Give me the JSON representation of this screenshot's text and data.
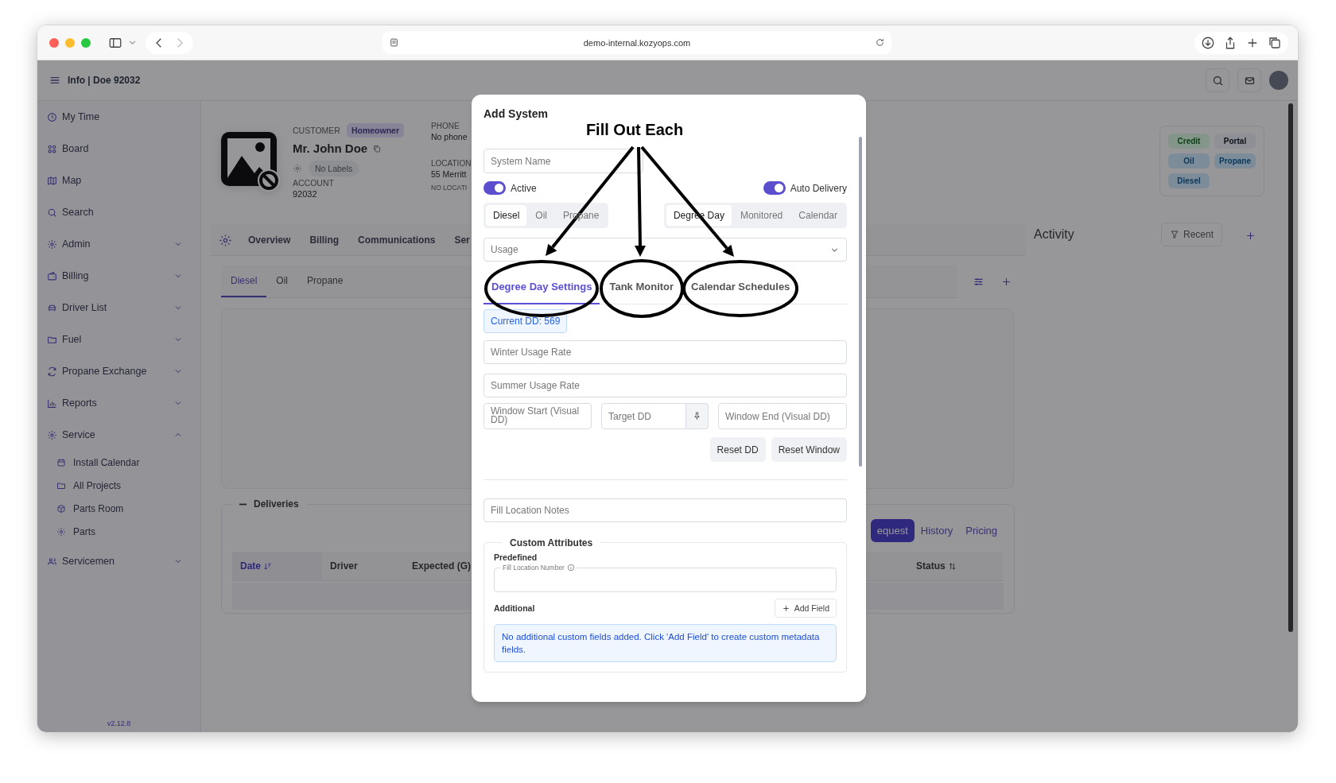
{
  "browser": {
    "url": "demo-internal.kozyops.com"
  },
  "header": {
    "title": "Info | Doe 92032"
  },
  "sidebar": {
    "items": [
      {
        "label": "My Time",
        "kind": "link"
      },
      {
        "label": "Board",
        "kind": "link"
      },
      {
        "label": "Map",
        "kind": "link"
      },
      {
        "label": "Search",
        "kind": "link"
      },
      {
        "label": "Admin",
        "kind": "group",
        "expanded": false
      },
      {
        "label": "Billing",
        "kind": "group",
        "expanded": false
      },
      {
        "label": "Driver List",
        "kind": "group",
        "expanded": false
      },
      {
        "label": "Fuel",
        "kind": "group",
        "expanded": false
      },
      {
        "label": "Propane Exchange",
        "kind": "group",
        "expanded": false
      },
      {
        "label": "Reports",
        "kind": "group",
        "expanded": false
      },
      {
        "label": "Service",
        "kind": "group",
        "expanded": true,
        "children": [
          {
            "label": "Install Calendar"
          },
          {
            "label": "All Projects"
          },
          {
            "label": "Parts Room"
          },
          {
            "label": "Parts"
          }
        ]
      },
      {
        "label": "Servicemen",
        "kind": "group",
        "expanded": false
      }
    ],
    "version": "v2.12.8"
  },
  "customer": {
    "label": "CUSTOMER",
    "badge": "Homeowner",
    "name": "Mr. John Doe",
    "labels": "No Labels",
    "account_label": "ACCOUNT",
    "account": "92032",
    "phone_label": "PHONE",
    "phone": "No phone",
    "location_label": "LOCATION",
    "location": "55 Merritt",
    "location_note": "NO LOCATI"
  },
  "tags": [
    {
      "label": "Credit",
      "color": "#849689"
    },
    {
      "label": "Portal",
      "color": "#8e9095"
    },
    {
      "label": "Oil",
      "color": "#7d8c99"
    },
    {
      "label": "Propane",
      "color": "#7d8c99"
    },
    {
      "label": "Diesel",
      "color": "#7d8c99"
    }
  ],
  "tabs": [
    {
      "label": "Overview",
      "selected": false
    },
    {
      "label": "Billing",
      "selected": false
    },
    {
      "label": "Communications",
      "selected": false
    },
    {
      "label": "Ser",
      "selected": false
    }
  ],
  "fuel_tabs": [
    {
      "label": "Diesel",
      "selected": true
    },
    {
      "label": "Oil",
      "selected": false
    },
    {
      "label": "Propane",
      "selected": false
    }
  ],
  "activity": {
    "title": "Activity",
    "filter": "Recent"
  },
  "deliveries": {
    "title": "Deliveries",
    "buttons": [
      {
        "label": "equest",
        "selected": true
      },
      {
        "label": "History",
        "selected": false
      },
      {
        "label": "Pricing",
        "selected": false
      }
    ],
    "columns": [
      {
        "label": "Date",
        "kind": "sorted"
      },
      {
        "label": "Driver",
        "kind": "plain"
      },
      {
        "label": "Expected (G)",
        "kind": "plain"
      },
      {
        "label": "Status",
        "kind": "sortable"
      }
    ]
  },
  "modal": {
    "title": "Add System",
    "system_name": {
      "placeholder": "System Name"
    },
    "toggles": [
      {
        "label": "Active",
        "on": true
      },
      {
        "label": "Auto Delivery",
        "on": true
      }
    ],
    "fuel_types": [
      {
        "label": "Diesel",
        "selected": true
      },
      {
        "label": "Oil",
        "selected": false
      },
      {
        "label": "Propane",
        "selected": false
      }
    ],
    "modes": [
      {
        "label": "Degree Day",
        "selected": true
      },
      {
        "label": "Monitored",
        "selected": false
      },
      {
        "label": "Calendar",
        "selected": false
      }
    ],
    "usage": {
      "placeholder": "Usage"
    },
    "tabs": [
      {
        "label": "Degree Day Settings",
        "selected": true
      },
      {
        "label": "Tank Monitor",
        "selected": false
      },
      {
        "label": "Calendar Schedules",
        "selected": false
      }
    ],
    "current_dd": "Current DD: 569",
    "winter": {
      "placeholder": "Winter Usage Rate"
    },
    "summer": {
      "placeholder": "Summer Usage Rate"
    },
    "window_start": {
      "placeholder": "Window Start (Visual DD)"
    },
    "target_dd": {
      "placeholder": "Target DD"
    },
    "window_end": {
      "placeholder": "Window End (Visual DD)"
    },
    "buttons": [
      {
        "label": "Reset DD"
      },
      {
        "label": "Reset Window"
      }
    ],
    "notes": {
      "placeholder": "Fill Location Notes"
    },
    "custom": {
      "title": "Custom Attributes",
      "predefined_label": "Predefined",
      "fields": [
        {
          "label": "Fill Location Number"
        }
      ],
      "additional_label": "Additional",
      "add_button": "Add Field",
      "empty_note": "No additional custom fields added. Click 'Add Field' to create custom metadata fields."
    }
  },
  "annotation": {
    "text": "Fill Out Each"
  }
}
